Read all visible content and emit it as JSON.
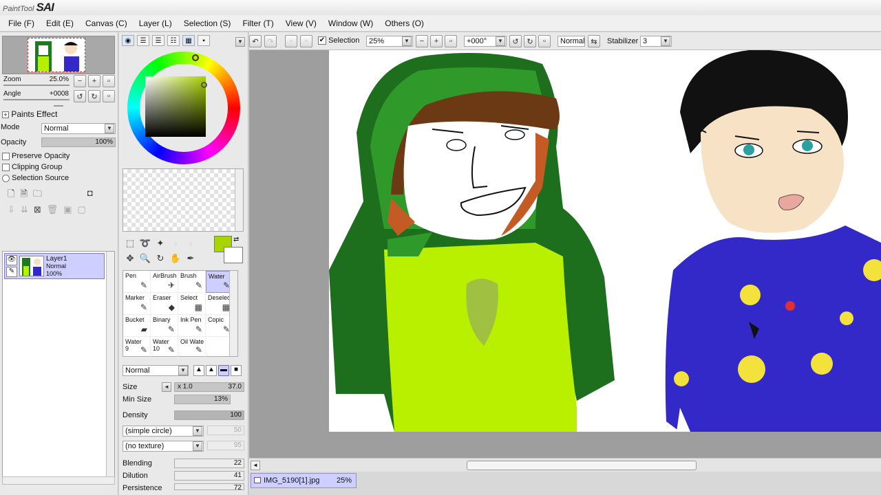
{
  "app": {
    "logo_small": "PaintTool",
    "logo_big": "SAI"
  },
  "menu": [
    "File (F)",
    "Edit (E)",
    "Canvas (C)",
    "Layer (L)",
    "Selection (S)",
    "Filter (T)",
    "View (V)",
    "Window (W)",
    "Others (O)"
  ],
  "navigator": {
    "zoom_label": "Zoom",
    "zoom_value": "25.0%",
    "angle_label": "Angle",
    "angle_value": "+0008"
  },
  "paints_effect": {
    "header": "Paints Effect",
    "mode_label": "Mode",
    "mode_value": "Normal",
    "opacity_label": "Opacity",
    "opacity_value": "100%",
    "preserve_opacity": "Preserve Opacity",
    "clipping_group": "Clipping Group",
    "selection_source": "Selection Source"
  },
  "layer": {
    "name": "Layer1",
    "mode": "Normal",
    "opacity": "100%"
  },
  "color": {
    "primary": "#a8d400",
    "secondary": "#ffffff"
  },
  "brushes": [
    {
      "label": "Pen",
      "icon": "✎"
    },
    {
      "label": "AirBrush",
      "icon": "✈"
    },
    {
      "label": "Brush",
      "icon": "✎"
    },
    {
      "label": "Water",
      "icon": "✎"
    },
    {
      "label": "Marker",
      "icon": "✎"
    },
    {
      "label": "Eraser",
      "icon": "◆"
    },
    {
      "label": "Select",
      "icon": "▦"
    },
    {
      "label": "Deselect",
      "icon": "▦"
    },
    {
      "label": "Bucket",
      "icon": "▰"
    },
    {
      "label": "Binary",
      "icon": "✎"
    },
    {
      "label": "Ink Pen",
      "icon": "✎"
    },
    {
      "label": "Copic",
      "icon": "✎"
    },
    {
      "label": "Water 9",
      "icon": "✎"
    },
    {
      "label": "Water 10",
      "icon": "✎"
    },
    {
      "label": "Oil Wate",
      "icon": "✎"
    }
  ],
  "brush_settings": {
    "blend_mode": "Normal",
    "size_label": "Size",
    "size_multiplier": "x 1.0",
    "size_value": "37.0",
    "min_size_label": "Min Size",
    "min_size_value": "13%",
    "density_label": "Density",
    "density_value": "100",
    "shape": "(simple circle)",
    "shape_value": "50",
    "texture": "(no texture)",
    "texture_value": "95",
    "blending_label": "Blending",
    "blending_value": "22",
    "dilution_label": "Dilution",
    "dilution_value": "41",
    "persistence_label": "Persistence",
    "persistence_value": "72"
  },
  "canvas_toolbar": {
    "selection_label": "Selection",
    "zoom": "25%",
    "angle": "+000°",
    "blend": "Normal",
    "stabilizer_label": "Stabilizer",
    "stabilizer_value": "3"
  },
  "document_tab": {
    "name": "IMG_5190[1].jpg",
    "zoom": "25%"
  }
}
